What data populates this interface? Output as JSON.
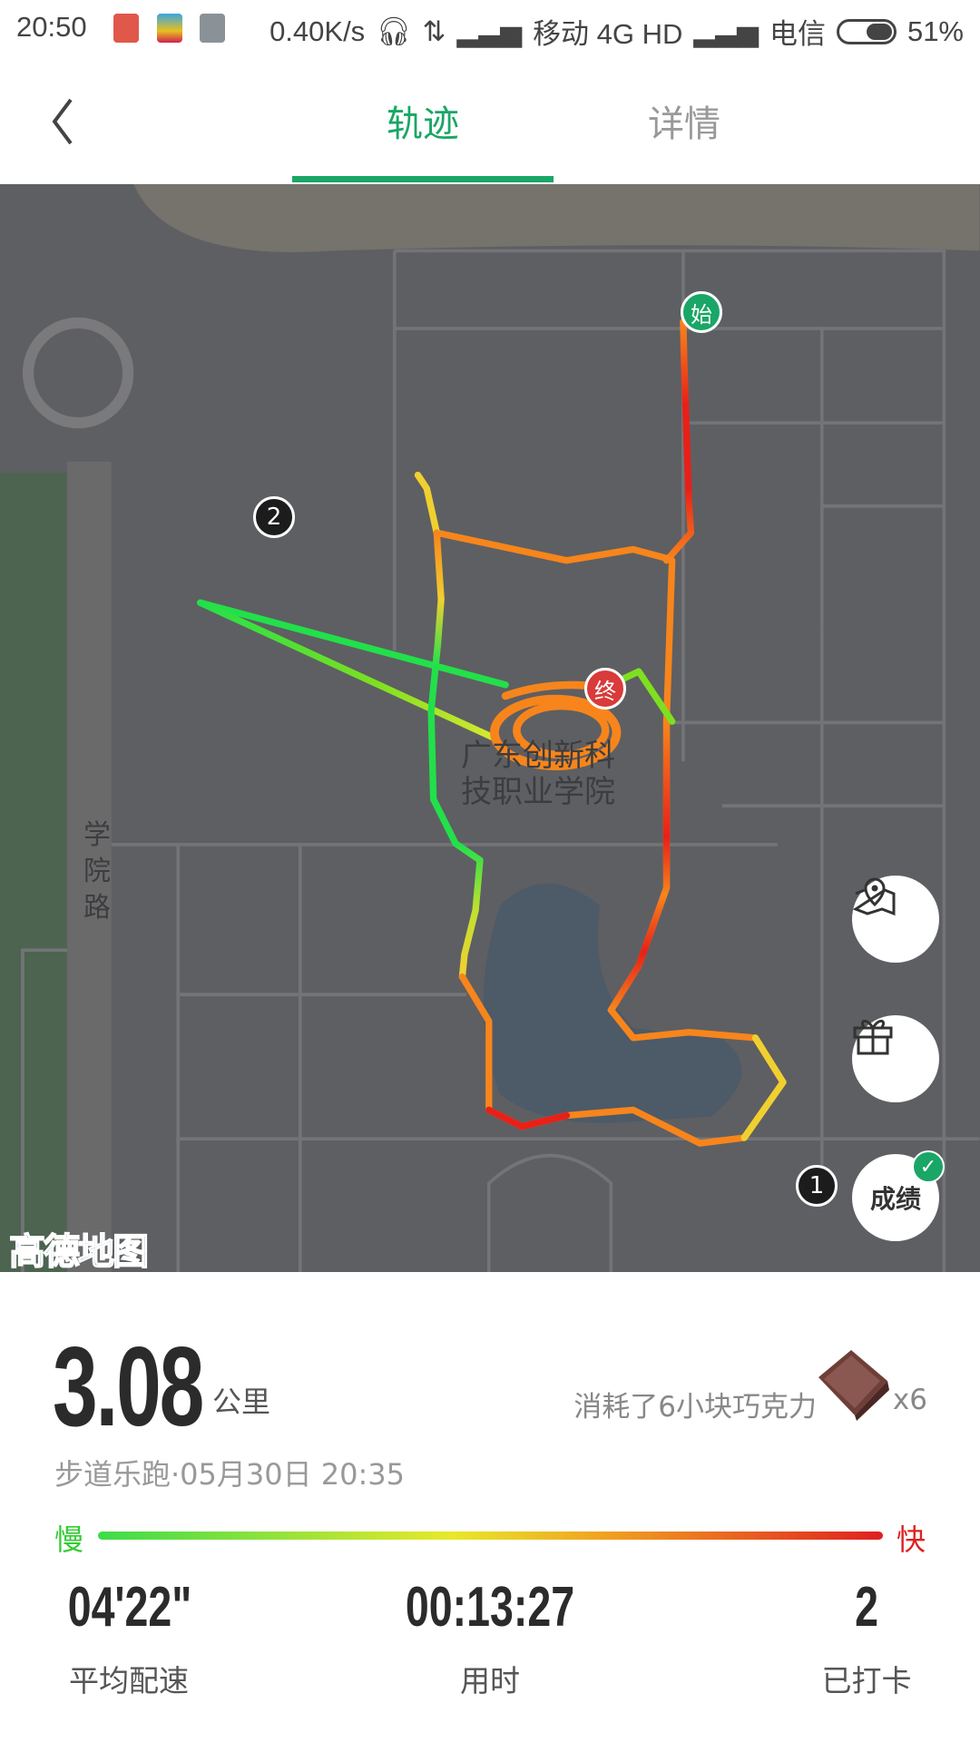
{
  "status_bar": {
    "time": "20:50",
    "net_speed": "0.40K/s",
    "carrier1": "移动 4G HD",
    "carrier2": "电信",
    "battery": "51%",
    "battery_level": 0.51
  },
  "header": {
    "tabs": [
      {
        "label": "轨迹",
        "active": true
      },
      {
        "label": "详情",
        "active": false
      }
    ]
  },
  "map": {
    "road_label": "学院路",
    "place_label_line1": "广东创新科",
    "place_label_line2": "技职业学院",
    "start_marker": "始",
    "end_marker": "终",
    "clusters": [
      "2",
      "1"
    ],
    "logo": "高德地图",
    "buttons": {
      "route_icon": "map-pin-icon",
      "gift_icon": "gift-icon",
      "score_label": "成绩"
    }
  },
  "summary": {
    "distance": "3.08",
    "distance_unit": "公里",
    "calories_text": "消耗了6小块巧克力",
    "chocolate_count": "x6",
    "subtitle": "步道乐跑·05月30日 20:35",
    "pace_legend": {
      "slow": "慢",
      "fast": "快"
    },
    "stats": [
      {
        "value": "04'22\"",
        "label": "平均配速"
      },
      {
        "value": "00:13:27",
        "label": "用时"
      },
      {
        "value": "2",
        "label": "已打卡"
      }
    ]
  },
  "colors": {
    "accent": "#1aa666",
    "slow": "#3ddc4a",
    "fast": "#e02020",
    "route_orange": "#f7851c"
  }
}
